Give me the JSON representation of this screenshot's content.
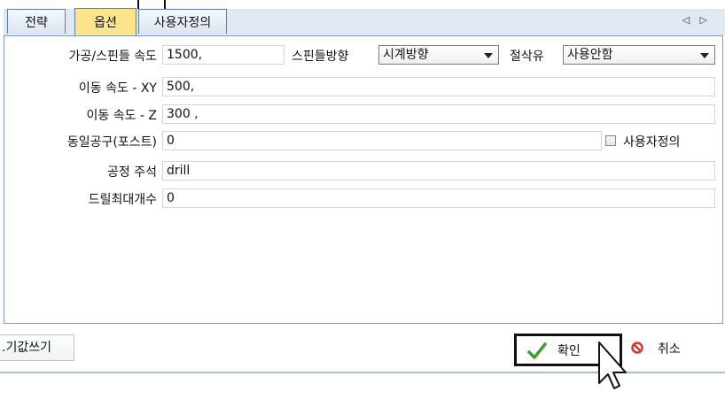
{
  "tabs": [
    {
      "label": "전략",
      "active": false
    },
    {
      "label": "옵션",
      "active": true
    },
    {
      "label": "사용자정의",
      "active": false
    }
  ],
  "tab_nav": "◁ ▷",
  "form": {
    "spindle_speed_label": "가공/스핀들 속도",
    "spindle_speed_value": "1500,",
    "spindle_dir_label": "스핀들방향",
    "spindle_dir_value": "시계방향",
    "coolant_label": "절삭유",
    "coolant_value": "사용안함",
    "feed_xy_label": "이동 속도 - XY",
    "feed_xy_value": "500,",
    "feed_z_label": "이동 속도 - Z",
    "feed_z_value": "300 ,",
    "same_tool_label": "동일공구(포스트)",
    "same_tool_value": "0",
    "custom_check_label": "사용자정의",
    "custom_checked": false,
    "comment_label": "공정 주석",
    "comment_value": "drill",
    "max_drill_label": "드릴최대개수",
    "max_drill_value": "0"
  },
  "bottom": {
    "left_button": ".기값쓰기",
    "ok_label": "확인",
    "cancel_label": "취소",
    "ok_icon": "check-icon",
    "cancel_icon": "no-entry-icon"
  },
  "colors": {
    "active_tab": "#fbe48a",
    "tab_border": "#5b7da8",
    "check_green": "#3aa12d",
    "cancel_red": "#e0362c"
  }
}
